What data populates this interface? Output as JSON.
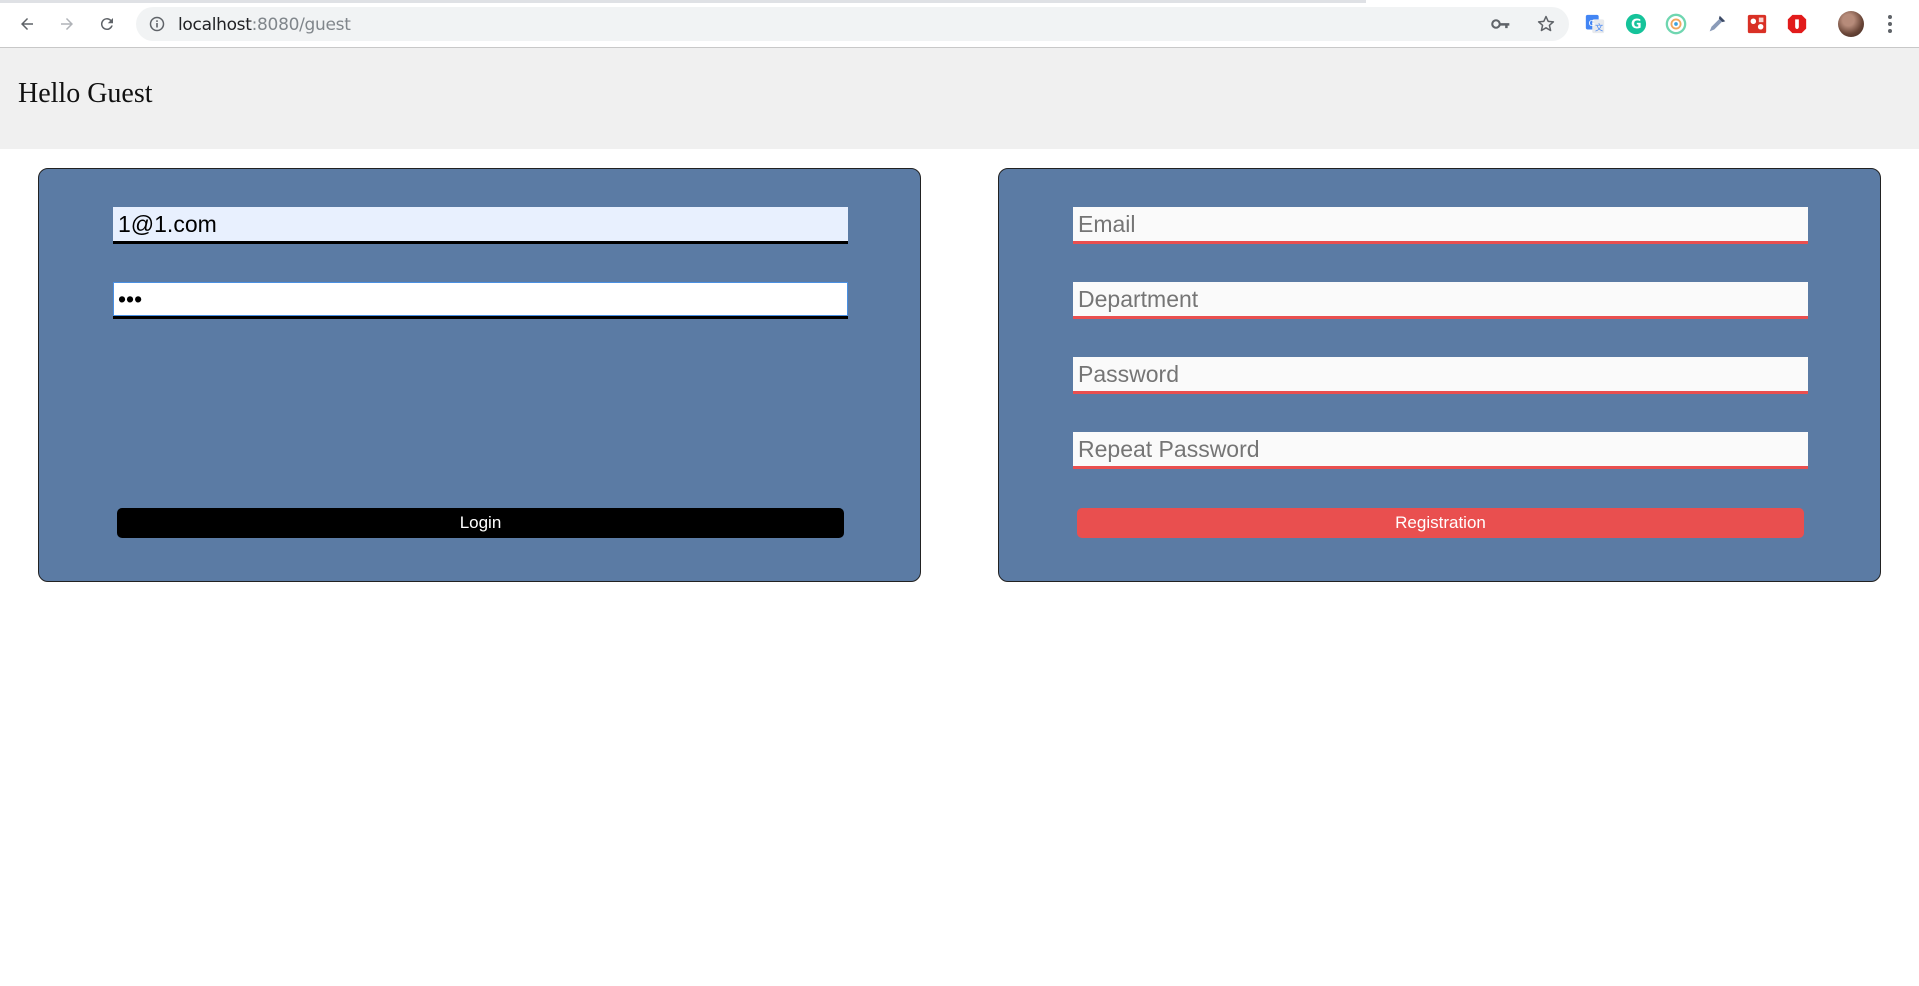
{
  "browser": {
    "url_host": "localhost",
    "url_path": ":8080/guest",
    "extensions": [
      "google-translate-icon",
      "grammarly-icon",
      "eye-extension-icon",
      "color-picker-icon",
      "puzzle-extension-icon",
      "adblock-icon"
    ]
  },
  "header": {
    "title": "Hello Guest"
  },
  "login": {
    "email_value": "1@1.com",
    "password_value": "•••",
    "button_label": "Login"
  },
  "registration": {
    "email_placeholder": "Email",
    "department_placeholder": "Department",
    "password_placeholder": "Password",
    "repeat_password_placeholder": "Repeat Password",
    "button_label": "Registration"
  },
  "colors": {
    "panel": "#5b7ba4",
    "login_button": "#000000",
    "registration_button": "#e94f4f",
    "header_bg": "#f0f0f0"
  }
}
